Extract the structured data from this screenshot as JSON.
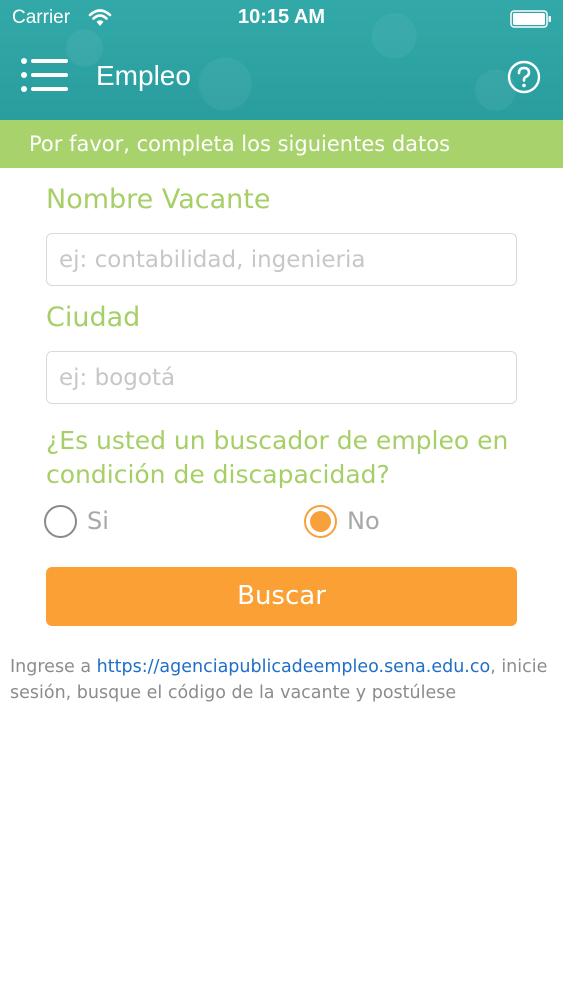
{
  "status_bar": {
    "carrier": "Carrier",
    "time": "10:15 AM"
  },
  "nav": {
    "title": "Empleo",
    "menu_icon": "hamburger-menu-icon",
    "help_icon": "question-circle-icon"
  },
  "banner": {
    "text": "Por favor, completa los siguientes datos"
  },
  "form": {
    "vacancy_label": "Nombre Vacante",
    "vacancy_placeholder": "ej: contabilidad, ingenieria",
    "vacancy_value": "",
    "city_label": "Ciudad",
    "city_placeholder": "ej: bogotá",
    "city_value": "",
    "question": "¿Es usted un buscador de empleo en condición de discapacidad?",
    "options": [
      {
        "label": "Si",
        "selected": false
      },
      {
        "label": "No",
        "selected": true
      }
    ],
    "submit_label": "Buscar"
  },
  "info": {
    "prefix": "Ingrese a ",
    "link": "https://agenciapublicadeempleo.sena.edu.co",
    "suffix": ", inicie sesión, busque el código de la vacante y postúlese"
  },
  "colors": {
    "header": "#2fa6a6",
    "banner": "#a8d26c",
    "label": "#a6cf67",
    "accent": "#fba035",
    "link": "#1e6fc8"
  }
}
